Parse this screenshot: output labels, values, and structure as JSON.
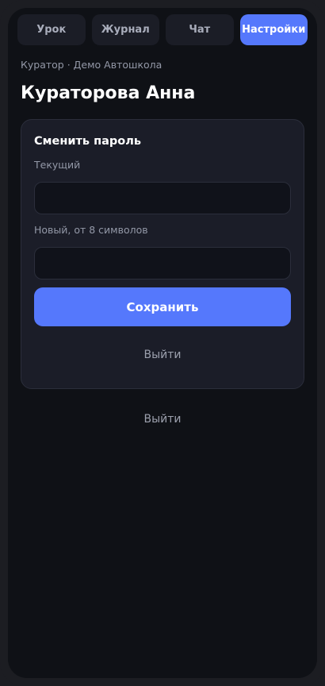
{
  "tabs": [
    {
      "label": "Урок",
      "active": false
    },
    {
      "label": "Журнал",
      "active": false
    },
    {
      "label": "Чат",
      "active": false
    },
    {
      "label": "Настройки",
      "active": true
    }
  ],
  "profile": {
    "subtitle": "Куратор · Демо Автошкола",
    "name": "Кураторова Анна"
  },
  "password_card": {
    "title": "Сменить пароль",
    "current_label": "Текущий",
    "current_value": "",
    "new_label": "Новый, от 8 символов",
    "new_value": "",
    "save_label": "Сохранить",
    "logout_label": "Выйти"
  },
  "footer": {
    "logout_label": "Выйти"
  },
  "colors": {
    "accent": "#5578fc",
    "background": "#0f1116",
    "card": "#1b1d28"
  }
}
